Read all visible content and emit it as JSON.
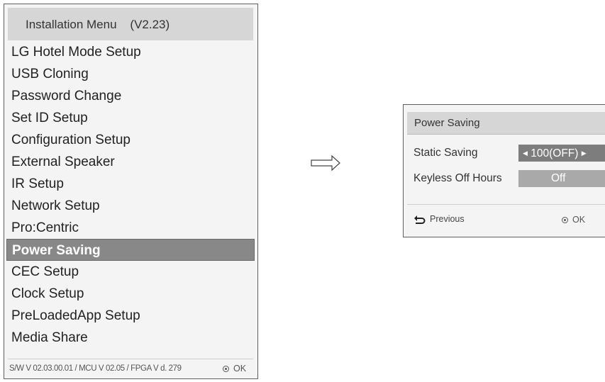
{
  "install_menu": {
    "title": "Installation Menu    (V2.23)",
    "items": [
      {
        "label": "LG Hotel Mode Setup",
        "selected": false
      },
      {
        "label": "USB Cloning",
        "selected": false
      },
      {
        "label": "Password Change",
        "selected": false
      },
      {
        "label": "Set ID Setup",
        "selected": false
      },
      {
        "label": "Configuration Setup",
        "selected": false
      },
      {
        "label": "External Speaker",
        "selected": false
      },
      {
        "label": "IR Setup",
        "selected": false
      },
      {
        "label": "Network Setup",
        "selected": false
      },
      {
        "label": "Pro:Centric",
        "selected": false
      },
      {
        "label": "Power Saving",
        "selected": true
      },
      {
        "label": "CEC Setup",
        "selected": false
      },
      {
        "label": "Clock Setup",
        "selected": false
      },
      {
        "label": "PreLoadedApp Setup",
        "selected": false
      },
      {
        "label": "Media Share",
        "selected": false
      }
    ],
    "footer": {
      "version": "S/W V 02.03.00.01 / MCU V 02.05 / FPGA V d. 279",
      "ok_label": "OK"
    }
  },
  "arrow_icon": "right-arrow-icon",
  "power_saving": {
    "title": "Power Saving",
    "rows": [
      {
        "label": "Static Saving",
        "value": "100(OFF)",
        "active": true
      },
      {
        "label": "Keyless Off Hours",
        "value": "Off",
        "active": false
      }
    ],
    "previous_label": "Previous",
    "ok_label": "OK"
  },
  "colors": {
    "selected_bg": "#888888",
    "header_bg": "#d6d6d6",
    "value_bg": "#a9a9a9",
    "active_value_bg": "#7d7d7d"
  }
}
